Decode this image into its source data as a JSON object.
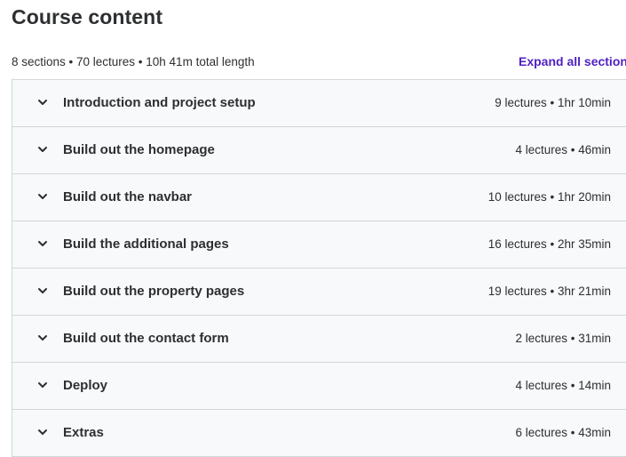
{
  "header": {
    "title": "Course content"
  },
  "summary": {
    "text": "8 sections • 70 lectures • 10h 41m total length",
    "expand_all_label": "Expand all sections"
  },
  "icons": {
    "chevron": "chevron-down-icon"
  },
  "colors": {
    "accent": "#5022c3",
    "section_bg": "#f7f9fa",
    "border": "#d1d7dc",
    "text": "#2d2f31"
  },
  "sections": [
    {
      "title": "Introduction and project setup",
      "meta": "9 lectures • 1hr 10min"
    },
    {
      "title": "Build out the homepage",
      "meta": "4 lectures • 46min"
    },
    {
      "title": "Build out the navbar",
      "meta": "10 lectures • 1hr 20min"
    },
    {
      "title": "Build the additional pages",
      "meta": "16 lectures • 2hr 35min"
    },
    {
      "title": "Build out the property pages",
      "meta": "19 lectures • 3hr 21min"
    },
    {
      "title": "Build out the contact form",
      "meta": "2 lectures • 31min"
    },
    {
      "title": "Deploy",
      "meta": "4 lectures • 14min"
    },
    {
      "title": "Extras",
      "meta": "6 lectures • 43min"
    }
  ]
}
